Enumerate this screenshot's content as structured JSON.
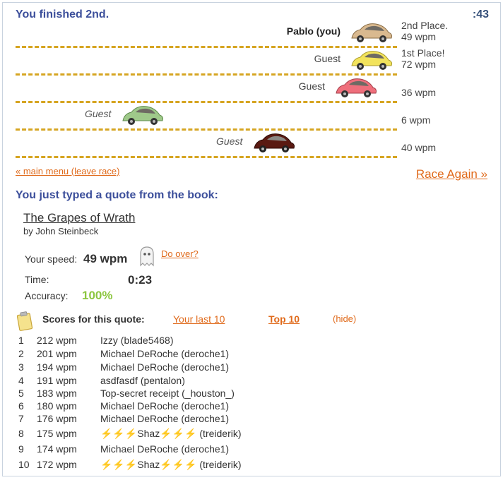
{
  "header": {
    "finish_text": "You finished 2nd.",
    "timer": ":43"
  },
  "racers": [
    {
      "name": "Pablo (you)",
      "style": "bold",
      "car_color": "#d9b98f",
      "place": "2nd Place.",
      "wpm": "49 wpm"
    },
    {
      "name": "Guest",
      "style": "normal",
      "car_color": "#f2e35c",
      "place": "1st Place!",
      "wpm": "72 wpm"
    },
    {
      "name": "Guest",
      "style": "normal",
      "car_color": "#ef6f7c",
      "place": "",
      "wpm": "36 wpm"
    },
    {
      "name": "Guest",
      "style": "italic",
      "car_color": "#9fc98a",
      "place": "",
      "wpm": "6 wpm"
    },
    {
      "name": "Guest",
      "style": "italic",
      "car_color": "#5a1a12",
      "place": "",
      "wpm": "40 wpm"
    }
  ],
  "links": {
    "main_menu": "« main menu (leave race)",
    "race_again": "Race Again »"
  },
  "quote": {
    "heading": "You just typed a quote from the book:",
    "title": "The Grapes of Wrath",
    "author": "by John Steinbeck"
  },
  "stats": {
    "speed_label": "Your speed:",
    "speed_value": "49 wpm",
    "do_over": "Do over?",
    "time_label": "Time:",
    "time_value": "0:23",
    "accuracy_label": "Accuracy:",
    "accuracy_value": "100%"
  },
  "scores": {
    "title": "Scores for this quote:",
    "tab_last": "Your last 10",
    "tab_top": "Top 10",
    "hide": "(hide)",
    "rows": [
      {
        "rank": "1",
        "wpm": "212 wpm",
        "user": "Izzy (blade5468)"
      },
      {
        "rank": "2",
        "wpm": "201 wpm",
        "user": "Michael DeRoche (deroche1)"
      },
      {
        "rank": "3",
        "wpm": "194 wpm",
        "user": "Michael DeRoche (deroche1)"
      },
      {
        "rank": "4",
        "wpm": "191 wpm",
        "user": "asdfasdf (pentalon)"
      },
      {
        "rank": "5",
        "wpm": "183 wpm",
        "user": "Top-secret receipt (_houston_)"
      },
      {
        "rank": "6",
        "wpm": "180 wpm",
        "user": "Michael DeRoche (deroche1)"
      },
      {
        "rank": "7",
        "wpm": "176 wpm",
        "user": "Michael DeRoche (deroche1)"
      },
      {
        "rank": "8",
        "wpm": "175 wpm",
        "user": "⚡⚡⚡Shaz⚡⚡⚡ (treiderik)"
      },
      {
        "rank": "9",
        "wpm": "174 wpm",
        "user": "Michael DeRoche (deroche1)"
      },
      {
        "rank": "10",
        "wpm": "172 wpm",
        "user": "⚡⚡⚡Shaz⚡⚡⚡ (treiderik)"
      }
    ]
  },
  "icons": {
    "ghost": "ghost-icon",
    "clipboard": "clipboard-icon",
    "car": "car-icon"
  }
}
